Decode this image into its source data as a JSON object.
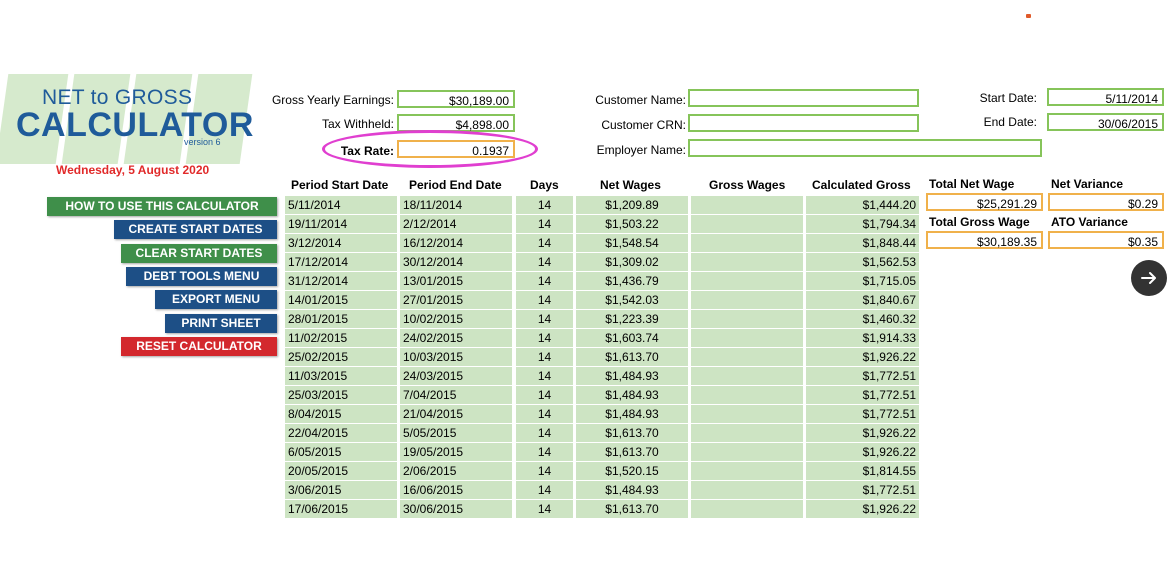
{
  "logo": {
    "line1": "NET to GROSS",
    "line2": "CALCULATOR",
    "version": "version 6"
  },
  "date": "Wednesday, 5 August 2020",
  "menu": [
    {
      "label": "HOW TO USE THIS CALCULATOR",
      "color": "#3f8f4a"
    },
    {
      "label": "CREATE START DATES",
      "color": "#1d4f86"
    },
    {
      "label": "CLEAR START DATES",
      "color": "#3f8f4a"
    },
    {
      "label": "DEBT TOOLS MENU",
      "color": "#1d4f86"
    },
    {
      "label": "EXPORT MENU",
      "color": "#1d4f86"
    },
    {
      "label": "PRINT SHEET",
      "color": "#1d4f86"
    },
    {
      "label": "RESET CALCULATOR",
      "color": "#d3282d"
    }
  ],
  "inputs": {
    "gross_yearly_label": "Gross Yearly Earnings:",
    "gross_yearly_value": "$30,189.00",
    "tax_withheld_label": "Tax Withheld:",
    "tax_withheld_value": "$4,898.00",
    "tax_rate_label": "Tax Rate:",
    "tax_rate_value": "0.1937",
    "customer_name_label": "Customer Name:",
    "customer_name_value": "",
    "customer_crn_label": "Customer CRN:",
    "customer_crn_value": "",
    "employer_name_label": "Employer Name:",
    "employer_name_value": "",
    "start_date_label": "Start Date:",
    "start_date_value": "5/11/2014",
    "end_date_label": "End Date:",
    "end_date_value": "30/06/2015"
  },
  "table": {
    "headers": [
      "Period Start Date",
      "Period End Date",
      "Days",
      "Net Wages",
      "Gross Wages",
      "Calculated Gross"
    ],
    "rows": [
      [
        "5/11/2014",
        "18/11/2014",
        "14",
        "$1,209.89",
        "",
        "$1,444.20"
      ],
      [
        "19/11/2014",
        "2/12/2014",
        "14",
        "$1,503.22",
        "",
        "$1,794.34"
      ],
      [
        "3/12/2014",
        "16/12/2014",
        "14",
        "$1,548.54",
        "",
        "$1,848.44"
      ],
      [
        "17/12/2014",
        "30/12/2014",
        "14",
        "$1,309.02",
        "",
        "$1,562.53"
      ],
      [
        "31/12/2014",
        "13/01/2015",
        "14",
        "$1,436.79",
        "",
        "$1,715.05"
      ],
      [
        "14/01/2015",
        "27/01/2015",
        "14",
        "$1,542.03",
        "",
        "$1,840.67"
      ],
      [
        "28/01/2015",
        "10/02/2015",
        "14",
        "$1,223.39",
        "",
        "$1,460.32"
      ],
      [
        "11/02/2015",
        "24/02/2015",
        "14",
        "$1,603.74",
        "",
        "$1,914.33"
      ],
      [
        "25/02/2015",
        "10/03/2015",
        "14",
        "$1,613.70",
        "",
        "$1,926.22"
      ],
      [
        "11/03/2015",
        "24/03/2015",
        "14",
        "$1,484.93",
        "",
        "$1,772.51"
      ],
      [
        "25/03/2015",
        "7/04/2015",
        "14",
        "$1,484.93",
        "",
        "$1,772.51"
      ],
      [
        "8/04/2015",
        "21/04/2015",
        "14",
        "$1,484.93",
        "",
        "$1,772.51"
      ],
      [
        "22/04/2015",
        "5/05/2015",
        "14",
        "$1,613.70",
        "",
        "$1,926.22"
      ],
      [
        "6/05/2015",
        "19/05/2015",
        "14",
        "$1,613.70",
        "",
        "$1,926.22"
      ],
      [
        "20/05/2015",
        "2/06/2015",
        "14",
        "$1,520.15",
        "",
        "$1,814.55"
      ],
      [
        "3/06/2015",
        "16/06/2015",
        "14",
        "$1,484.93",
        "",
        "$1,772.51"
      ],
      [
        "17/06/2015",
        "30/06/2015",
        "14",
        "$1,613.70",
        "",
        "$1,926.22"
      ]
    ]
  },
  "summary": {
    "total_net_wage_label": "Total Net Wage",
    "total_net_wage_value": "$25,291.29",
    "net_variance_label": "Net Variance",
    "net_variance_value": "$0.29",
    "total_gross_wage_label": "Total Gross Wage",
    "total_gross_wage_value": "$30,189.35",
    "ato_variance_label": "ATO Variance",
    "ato_variance_value": "$0.35"
  },
  "next_icon": "arrow-right-icon",
  "colors": {
    "field_border": "#86c45a",
    "highlight_border": "#f0b14b",
    "table_fill": "#cde4c3",
    "annotation": "#e03fd0"
  }
}
